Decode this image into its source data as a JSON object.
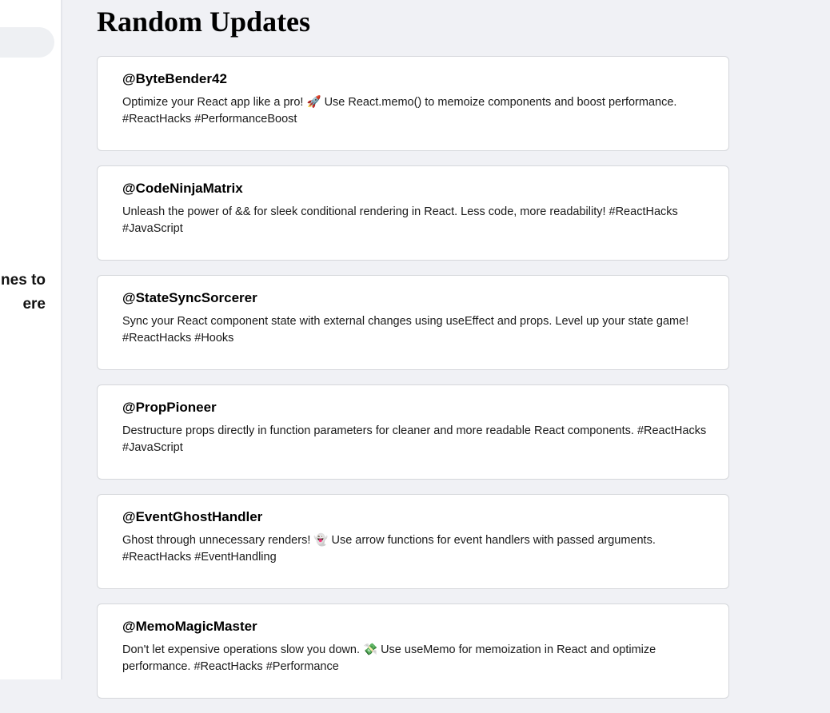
{
  "sidebar": {
    "partial_text_lines": [
      "nes to",
      "ere"
    ]
  },
  "main": {
    "title": "Random Updates",
    "posts": [
      {
        "user": "@ByteBender42",
        "text": "Optimize your React app like a pro! 🚀 Use React.memo() to memoize components and boost performance. #ReactHacks #PerformanceBoost"
      },
      {
        "user": "@CodeNinjaMatrix",
        "text": "Unleash the power of && for sleek conditional rendering in React. Less code, more readability! #ReactHacks #JavaScript"
      },
      {
        "user": "@StateSyncSorcerer",
        "text": "Sync your React component state with external changes using useEffect and props. Level up your state game! #ReactHacks #Hooks"
      },
      {
        "user": "@PropPioneer",
        "text": "Destructure props directly in function parameters for cleaner and more readable React components. #ReactHacks #JavaScript"
      },
      {
        "user": "@EventGhostHandler",
        "text": "Ghost through unnecessary renders! 👻 Use arrow functions for event handlers with passed arguments. #ReactHacks #EventHandling"
      },
      {
        "user": "@MemoMagicMaster",
        "text": "Don't let expensive operations slow you down. 💸 Use useMemo for memoization in React and optimize performance. #ReactHacks #Performance"
      }
    ]
  }
}
